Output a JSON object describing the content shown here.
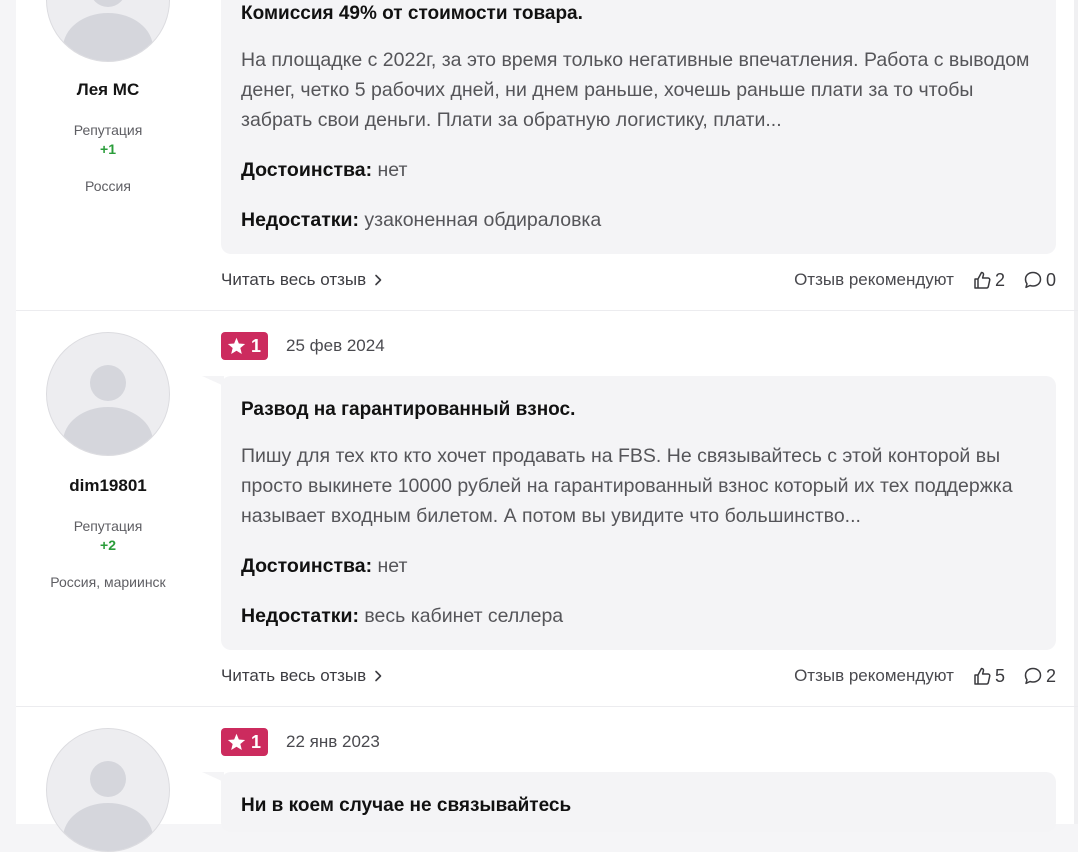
{
  "reviews": [
    {
      "author": {
        "name": "Лея МС",
        "reputation_label": "Репутация",
        "reputation_value": "+1",
        "location": "Россия"
      },
      "title": "Комиссия 49% от стоимости товара.",
      "text": "На площадке с 2022г, за это время только негативные впечатления. Работа с выводом денег, четко 5 рабочих дней, ни днем раньше, хочешь раньше плати за то чтобы забрать свои деньги. Плати за обратную логистику, плати...",
      "pros_label": "Достоинства:",
      "pros": "нет",
      "cons_label": "Недостатки:",
      "cons": "узаконенная обдираловка",
      "read_more": "Читать весь отзыв",
      "recommend_label": "Отзыв рекомендуют",
      "likes": "2",
      "comments": "0"
    },
    {
      "author": {
        "name": "dim19801",
        "reputation_label": "Репутация",
        "reputation_value": "+2",
        "location": "Россия, мариинск"
      },
      "rating": "1",
      "date": "25 фев 2024",
      "title": "Развод на гарантированный взнос.",
      "text": "Пишу для тех кто кто хочет продавать на FBS. Не связывайтесь с этой конторой вы просто выкинете 10000 рублей на гарантированный взнос который их тех поддержка называет входным билетом. А потом вы увидите что большинство...",
      "pros_label": "Достоинства:",
      "pros": "нет",
      "cons_label": "Недостатки:",
      "cons": "весь кабинет селлера",
      "read_more": "Читать весь отзыв",
      "recommend_label": "Отзыв рекомендуют",
      "likes": "5",
      "comments": "2"
    },
    {
      "rating": "1",
      "date": "22 янв 2023",
      "title": "Ни в коем случае не связывайтесь"
    }
  ],
  "colors": {
    "rating_badge": "#cc2b5e",
    "reputation_positive": "#2a9d3a",
    "bubble_bg": "#f4f4f6"
  },
  "icons": {
    "star": "star-icon",
    "like": "thumbs-up-icon",
    "comment": "comment-icon",
    "chevron": "chevron-right-icon"
  }
}
